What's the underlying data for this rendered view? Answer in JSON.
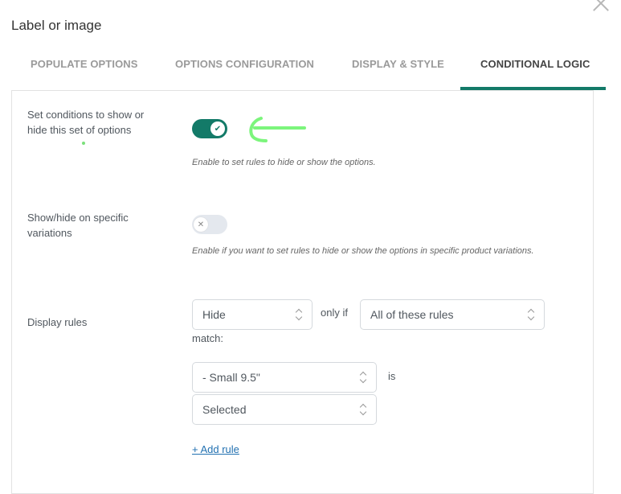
{
  "dialog": {
    "title": "Label or image",
    "close_icon": "close-icon"
  },
  "tabs": [
    {
      "label": "POPULATE OPTIONS",
      "active": false
    },
    {
      "label": "OPTIONS CONFIGURATION",
      "active": false
    },
    {
      "label": "DISPLAY & STYLE",
      "active": false
    },
    {
      "label": "CONDITIONAL LOGIC",
      "active": true
    }
  ],
  "colors": {
    "accent": "#137a68",
    "annotation": "#7cf57c",
    "link": "#2271b1"
  },
  "fields": {
    "set_conditions": {
      "label": "Set conditions to show or hide this set of options",
      "enabled": true,
      "help": "Enable to set rules to hide or show the options."
    },
    "variations": {
      "label": "Show/hide on specific variations",
      "enabled": false,
      "help": "Enable if you want to set rules to hide or show the options in specific product variations."
    },
    "display_rules": {
      "label": "Display rules",
      "action_select": "Hide",
      "only_if": "only if",
      "match_select": "All of these rules",
      "match": "match:",
      "rule": {
        "field_select": "- Small 9.5\"",
        "is": "is",
        "state_select": "Selected"
      },
      "add_rule": "+ Add rule"
    }
  },
  "annotation": {
    "type": "arrow-left",
    "note": "hand-drawn green arrow pointing to toggle"
  }
}
